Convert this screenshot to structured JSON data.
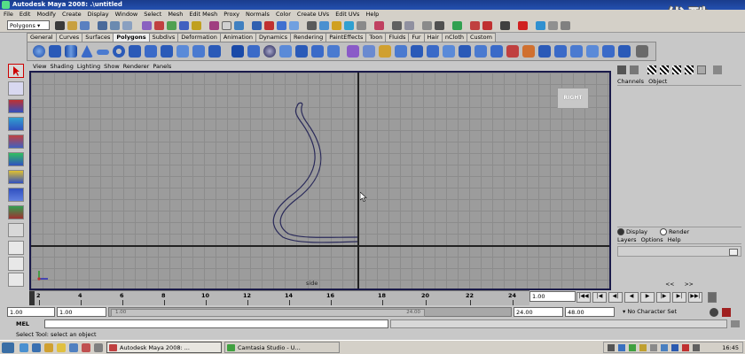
{
  "window": {
    "title": "Autodesk Maya 2008: .\\untitled"
  },
  "logo_text": "优酷",
  "menubar": {
    "items": [
      "File",
      "Edit",
      "Modify",
      "Create",
      "Display",
      "Window",
      "Select",
      "Mesh",
      "Edit Mesh",
      "Proxy",
      "Normals",
      "Color",
      "Create UVs",
      "Edit UVs",
      "Help"
    ]
  },
  "status_line": {
    "mode": "Polygons"
  },
  "shelf": {
    "tabs": [
      "General",
      "Curves",
      "Surfaces",
      "Polygons",
      "Subdivs",
      "Deformation",
      "Animation",
      "Dynamics",
      "Rendering",
      "PaintEffects",
      "Toon",
      "Fluids",
      "Fur",
      "Hair",
      "nCloth",
      "Custom"
    ],
    "active_tab": "Polygons"
  },
  "panel_menu": {
    "items": [
      "View",
      "Shading",
      "Lighting",
      "Show",
      "Renderer",
      "Panels"
    ]
  },
  "viewport": {
    "view_cube_label": "RIGHT",
    "camera_label": "side"
  },
  "channel_box": {
    "menu": [
      "Channels",
      "Object"
    ]
  },
  "layer_editor": {
    "display_label": "Display",
    "render_label": "Render",
    "menu": [
      "Layers",
      "Options",
      "Help"
    ]
  },
  "time_slider": {
    "ticks": [
      "2",
      "4",
      "6",
      "8",
      "10",
      "12",
      "14",
      "16",
      "18",
      "20",
      "22",
      "24"
    ],
    "current_frame": "1.00"
  },
  "range_slider": {
    "start_time": "1.00",
    "playback_start": "1.00",
    "slider_start": "1.00",
    "slider_end": "24.00",
    "playback_end": "24.00",
    "end_time": "48.00",
    "character_set": "No Character Set"
  },
  "command_line": {
    "label": "MEL"
  },
  "help_line": {
    "text": "Select Tool: select an object"
  },
  "taskbar": {
    "items": [
      "Autodesk Maya 2008: ...",
      "Camtasia Studio - U..."
    ],
    "clock": "16:45"
  }
}
